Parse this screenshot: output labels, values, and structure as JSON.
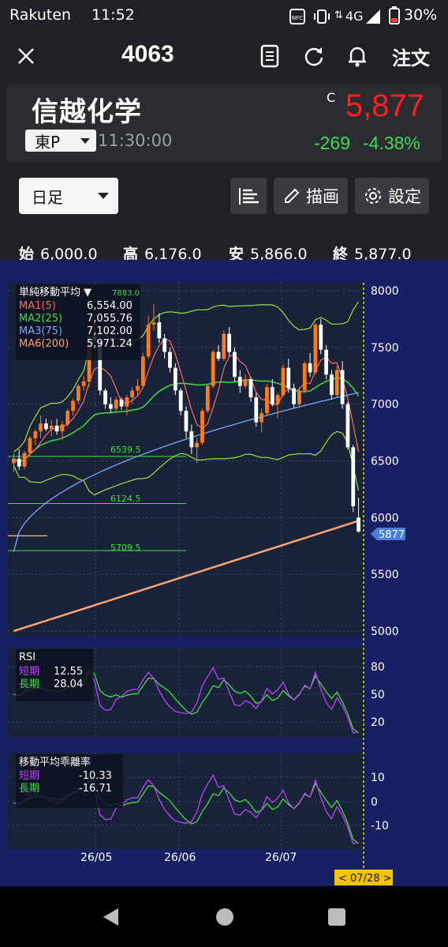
{
  "status_bar": {
    "carrier": "Rakuten",
    "time": "11:52",
    "network": "4G",
    "battery": "30%"
  },
  "top_bar": {
    "stock_code": "4063",
    "order_label": "注文",
    "icons": [
      "close-icon",
      "document-icon",
      "refresh-icon",
      "bell-icon"
    ]
  },
  "quote": {
    "name": "信越化学",
    "market": "東P",
    "quote_time": "11:30:00",
    "price_flag": "C",
    "price": "5,877",
    "change": "-269",
    "change_pct": "-4.38%",
    "colors": {
      "price": "#ff1f1f",
      "change": "#3ddc5c"
    }
  },
  "controls": {
    "period": "日足",
    "draw_label": "描画",
    "settings_label": "設定",
    "icons": [
      "list-icon",
      "pencil-icon",
      "gear-icon"
    ]
  },
  "ohlc": {
    "open_label": "始",
    "open": "6,000.0",
    "high_label": "高",
    "high": "6,176.0",
    "low_label": "安",
    "low": "5,866.0",
    "close_label": "終",
    "close": "5,877.0"
  },
  "ma_legend": {
    "title": "単純移動平均 ▼",
    "max_label": "7883.0",
    "rows": [
      {
        "name": "MA1(5)",
        "value": "6,554.00",
        "color": "#ff6b6b"
      },
      {
        "name": "MA2(25)",
        "value": "7,055.76",
        "color": "#3ee03e"
      },
      {
        "name": "MA3(75)",
        "value": "7,102.00",
        "color": "#7aa8ff"
      },
      {
        "name": "MA6(200)",
        "value": "5,971.24",
        "color": "#ffa070"
      }
    ]
  },
  "price_axis": [
    "8000",
    "7500",
    "7000",
    "6500",
    "6000",
    "5500",
    "5000"
  ],
  "current_price_tag": "5877",
  "level_labels": [
    "6539.5",
    "6124.5",
    "5709.5"
  ],
  "rsi": {
    "title": "RSI",
    "short_label": "短期",
    "short_value": "12.55",
    "long_label": "長期",
    "long_value": "28.04",
    "axis": [
      "80",
      "50",
      "20"
    ]
  },
  "deviation": {
    "title": "移動平均乖離率",
    "short_label": "短期",
    "short_value": "-10.33",
    "long_label": "長期",
    "long_value": "-16.71",
    "axis": [
      "10",
      "0",
      "-10"
    ]
  },
  "date_axis": [
    "26/05",
    "26/06",
    "26/07"
  ],
  "cursor_date": "< 07/28 >",
  "nav": {
    "icons": [
      "back-icon",
      "home-icon",
      "recents-icon"
    ]
  },
  "chart_data": {
    "type": "candlestick",
    "y_range": [
      5000,
      8000
    ],
    "candles": [
      [
        6480,
        6560,
        6400,
        6520
      ],
      [
        6520,
        6600,
        6420,
        6450
      ],
      [
        6450,
        6590,
        6430,
        6570
      ],
      [
        6570,
        6720,
        6540,
        6700
      ],
      [
        6700,
        6780,
        6640,
        6760
      ],
      [
        6760,
        6900,
        6700,
        6830
      ],
      [
        6830,
        6870,
        6760,
        6780
      ],
      [
        6780,
        6860,
        6720,
        6810
      ],
      [
        6810,
        6870,
        6730,
        6760
      ],
      [
        6760,
        6850,
        6700,
        6820
      ],
      [
        6820,
        6960,
        6800,
        6940
      ],
      [
        6940,
        7050,
        6900,
        7030
      ],
      [
        7030,
        7180,
        7000,
        7160
      ],
      [
        7160,
        7250,
        7120,
        7200
      ],
      [
        7200,
        7650,
        7150,
        7600
      ],
      [
        7600,
        7780,
        7550,
        7560
      ],
      [
        7560,
        7600,
        7080,
        7120
      ],
      [
        7120,
        7140,
        6960,
        7000
      ],
      [
        7000,
        7060,
        6920,
        6960
      ],
      [
        6960,
        7060,
        6930,
        7040
      ],
      [
        7040,
        7060,
        6950,
        6980
      ],
      [
        6980,
        7080,
        6900,
        7060
      ],
      [
        7060,
        7150,
        7000,
        7120
      ],
      [
        7120,
        7220,
        7080,
        7160
      ],
      [
        7160,
        7450,
        7140,
        7420
      ],
      [
        7420,
        7780,
        7400,
        7700
      ],
      [
        7700,
        7880,
        7650,
        7720
      ],
      [
        7720,
        7800,
        7540,
        7580
      ],
      [
        7580,
        7620,
        7400,
        7460
      ],
      [
        7460,
        7500,
        7280,
        7320
      ],
      [
        7320,
        7360,
        7080,
        7120
      ],
      [
        7120,
        7140,
        6900,
        6940
      ],
      [
        6940,
        6980,
        6700,
        6760
      ],
      [
        6760,
        6820,
        6560,
        6620
      ],
      [
        6620,
        6700,
        6480,
        6660
      ],
      [
        6660,
        6960,
        6640,
        6940
      ],
      [
        6940,
        7180,
        6920,
        7160
      ],
      [
        7160,
        7480,
        7140,
        7460
      ],
      [
        7460,
        7520,
        7380,
        7400
      ],
      [
        7400,
        7650,
        7380,
        7620
      ],
      [
        7620,
        7680,
        7420,
        7460
      ],
      [
        7460,
        7500,
        7200,
        7240
      ],
      [
        7240,
        7300,
        7100,
        7160
      ],
      [
        7160,
        7260,
        7140,
        7220
      ],
      [
        7220,
        7240,
        7020,
        7060
      ],
      [
        7060,
        7100,
        6800,
        6840
      ],
      [
        6840,
        6960,
        6750,
        6920
      ],
      [
        6920,
        7180,
        6900,
        7150
      ],
      [
        7150,
        7220,
        6980,
        7000
      ],
      [
        7000,
        7100,
        6880,
        7080
      ],
      [
        7080,
        7350,
        7060,
        7320
      ],
      [
        7320,
        7400,
        7100,
        7140
      ],
      [
        7140,
        7180,
        6960,
        7000
      ],
      [
        7000,
        7150,
        6980,
        7120
      ],
      [
        7120,
        7380,
        7100,
        7360
      ],
      [
        7360,
        7450,
        7240,
        7280
      ],
      [
        7280,
        7720,
        7260,
        7700
      ],
      [
        7700,
        7750,
        7440,
        7480
      ],
      [
        7480,
        7520,
        7220,
        7260
      ],
      [
        7260,
        7300,
        7040,
        7080
      ],
      [
        7080,
        7340,
        7060,
        7300
      ],
      [
        7300,
        7380,
        6960,
        7000
      ],
      [
        7000,
        7020,
        6600,
        6620
      ],
      [
        6620,
        6640,
        6050,
        6100
      ],
      [
        6000,
        6176,
        5866,
        5877
      ]
    ],
    "ma200_range": [
      5000,
      5971.24
    ]
  }
}
